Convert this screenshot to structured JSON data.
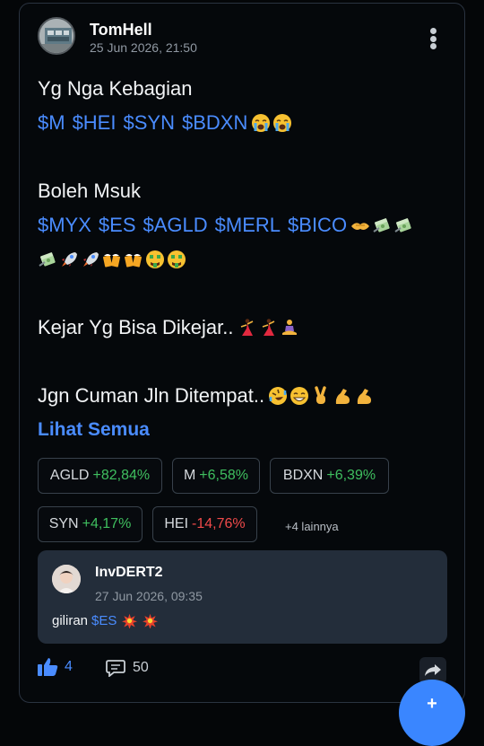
{
  "post": {
    "author": "TomHell",
    "timestamp": "25 Jun 2026, 21:50",
    "line1_text": "Yg Nga Kebagian",
    "line2_tickers": [
      "$M",
      "$HEI",
      "$SYN",
      "$BDXN"
    ],
    "line3_text": "Boleh Msuk",
    "line4_tickers": [
      "$MYX",
      "$ES",
      "$AGLD",
      "$MERL",
      "$BICO"
    ],
    "line6_text": "Kejar Yg Bisa Dikejar..",
    "line7_text": "Jgn Cuman Jln Ditempat..",
    "see_all": "Lihat Semua",
    "emoji_names": [
      "crying-face-icon",
      "handshake-icon",
      "money-with-wings-icon",
      "rocket-icon",
      "beer-mugs-icon",
      "money-mouth-face-icon",
      "dancer-icon",
      "meditation-icon",
      "rofl-icon",
      "grinning-face-icon",
      "victory-hand-icon",
      "flexed-biceps-icon"
    ]
  },
  "stocks": [
    {
      "symbol": "AGLD",
      "change": "+82,84%",
      "direction": "up"
    },
    {
      "symbol": "M",
      "change": "+6,58%",
      "direction": "up"
    },
    {
      "symbol": "BDXN",
      "change": "+6,39%",
      "direction": "up"
    },
    {
      "symbol": "SYN",
      "change": "+4,17%",
      "direction": "up"
    },
    {
      "symbol": "HEI",
      "change": "-14,76%",
      "direction": "down"
    }
  ],
  "more_stocks": "+4 lainnya",
  "comment": {
    "author": "InvDERT2",
    "timestamp": "27 Jun 2026, 09:35",
    "text": "giliran",
    "ticker": "$ES"
  },
  "actions": {
    "likes": "4",
    "comments": "50"
  },
  "colors": {
    "accent": "#4a8cff",
    "positive": "#3fbf5f",
    "negative": "#f04a4a",
    "background": "#040608",
    "comment_bg": "#232d3a"
  }
}
